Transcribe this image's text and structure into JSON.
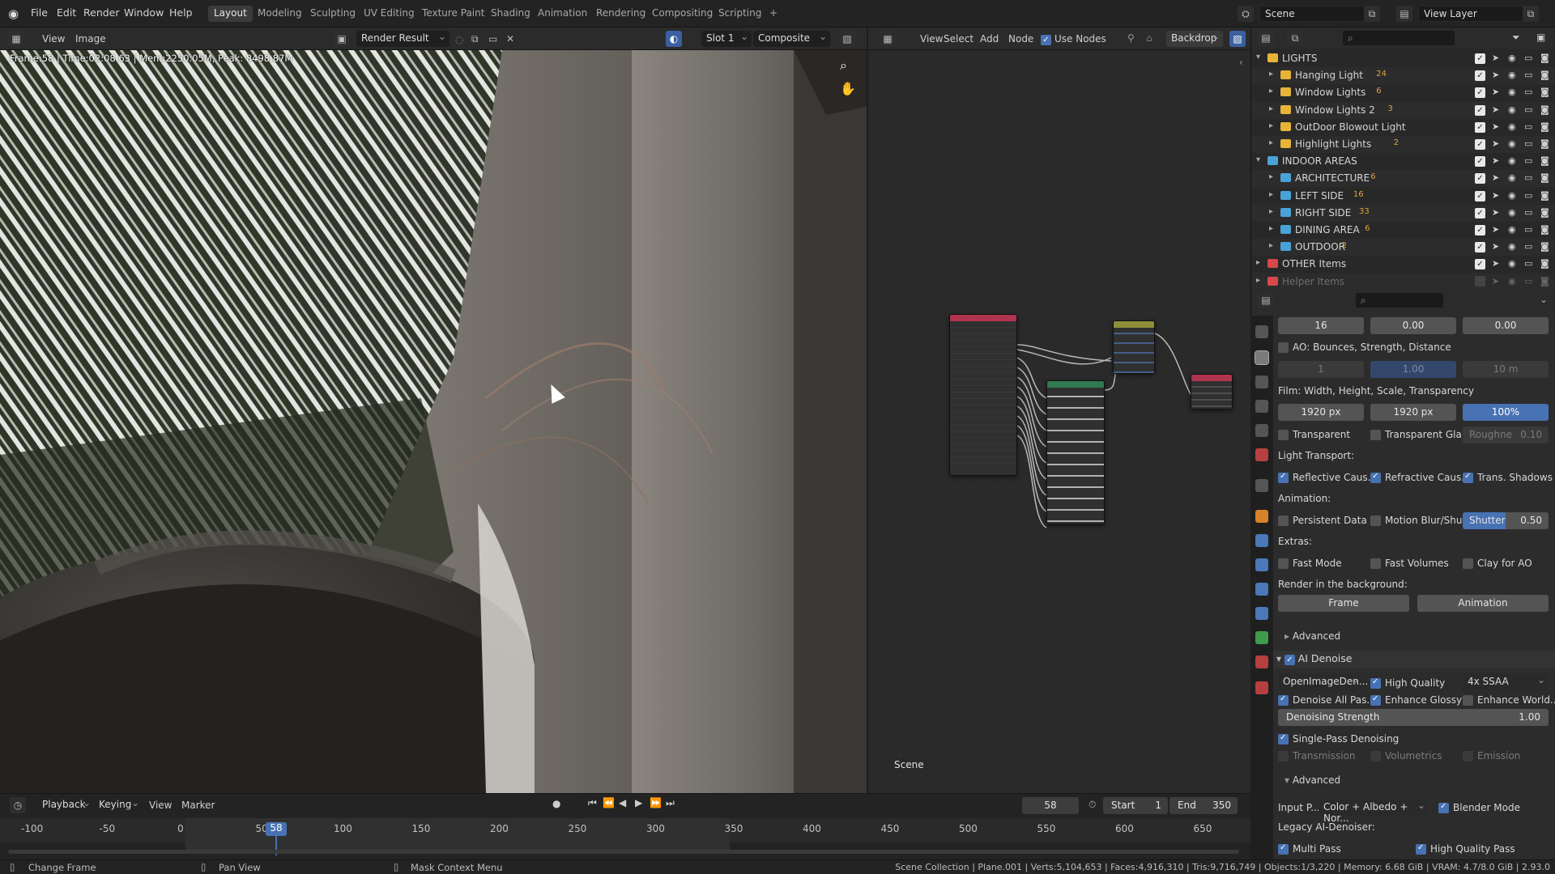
{
  "topbar": {
    "menus": [
      "File",
      "Edit",
      "Render",
      "Window",
      "Help"
    ],
    "workspaces": [
      "Layout",
      "Modeling",
      "Sculpting",
      "UV Editing",
      "Texture Paint",
      "Shading",
      "Animation",
      "Rendering",
      "Compositing",
      "Scripting"
    ],
    "active_workspace": "Layout",
    "add_tab": "+",
    "scene": "Scene",
    "view_layer": "View Layer"
  },
  "image_editor": {
    "menus": [
      "View",
      "Image"
    ],
    "image_name": "Render Result",
    "slot": "Slot 1",
    "layer": "Composite",
    "info": "Frame:58 | Time:02:08.63 | Mem:2250.05M, Peak: 8498.87M"
  },
  "node_editor": {
    "menus": [
      "View",
      "Select",
      "Add",
      "Node"
    ],
    "use_nodes": "Use Nodes",
    "backdrop": "Backdrop",
    "scene_label": "Scene"
  },
  "outliner": {
    "rows": [
      {
        "name": "LIGHTS",
        "level": 0,
        "color": "#e8b339",
        "open": true,
        "badges": ""
      },
      {
        "name": "Hanging Light",
        "level": 1,
        "color": "#e8b339",
        "badges": "24"
      },
      {
        "name": "Window Lights",
        "level": 1,
        "color": "#e8b339",
        "badges": "6"
      },
      {
        "name": "Window Lights 2",
        "level": 1,
        "color": "#e8b339",
        "badges": "3"
      },
      {
        "name": "OutDoor Blowout Light",
        "level": 1,
        "color": "#e8b339",
        "badges": ""
      },
      {
        "name": "Highlight Lights",
        "level": 1,
        "color": "#e8b339",
        "badges": "2"
      },
      {
        "name": "INDOOR AREAS",
        "level": 0,
        "color": "#4aa3d8",
        "open": true,
        "badges": ""
      },
      {
        "name": "ARCHITECTURE",
        "level": 1,
        "color": "#4aa3d8",
        "badges": "6"
      },
      {
        "name": "LEFT SIDE",
        "level": 1,
        "color": "#4aa3d8",
        "badges": "16"
      },
      {
        "name": "RIGHT SIDE",
        "level": 1,
        "color": "#4aa3d8",
        "badges": "33"
      },
      {
        "name": "DINING AREA",
        "level": 1,
        "color": "#4aa3d8",
        "badges": "6"
      },
      {
        "name": "OUTDOOR",
        "level": 1,
        "color": "#4aa3d8",
        "badges": "2"
      },
      {
        "name": "OTHER Items",
        "level": 0,
        "color": "#d8484a",
        "open": false,
        "badges": ""
      },
      {
        "name": "Helper Items",
        "level": 0,
        "color": "#d8484a",
        "open": false,
        "badges": "",
        "disabled": true
      }
    ]
  },
  "properties": {
    "row1": [
      "16",
      "0.00",
      "0.00"
    ],
    "ao_label": "AO: Bounces, Strength, Distance",
    "ao_values": [
      "1",
      "1.00",
      "10 m"
    ],
    "film_label": "Film: Width, Height, Scale, Transparency",
    "film_values": [
      "1920 px",
      "1920 px",
      "100%"
    ],
    "transparent": "Transparent",
    "transparent_gla": "Transparent Gla...",
    "roughne": "Roughne",
    "roughne_value": "0.10",
    "light_transport": "Light Transport:",
    "reflective_caus": "Reflective Caus...",
    "refractive_caus": "Refractive Caus...",
    "trans_shadows": "Trans. Shadows",
    "animation_label": "Animation:",
    "persistent_data": "Persistent Data",
    "motion_blur": "Motion Blur/Shu...",
    "shutter": "Shutter",
    "shutter_value": "0.50",
    "extras_label": "Extras:",
    "fast_mode": "Fast Mode",
    "fast_volumes": "Fast Volumes",
    "clay_for_ao": "Clay for AO",
    "render_bg": "Render in the background:",
    "frame_btn": "Frame",
    "animation_btn": "Animation",
    "advanced": "Advanced",
    "ai_denoise": "AI Denoise",
    "denoiser": "OpenImageDen...",
    "high_quality": "High Quality",
    "ssaa": "4x SSAA",
    "denoise_all": "Denoise All Pas...",
    "enhance_glossy": "Enhance Glossy",
    "enhance_world": "Enhance World...",
    "denoising_strength": "Denoising Strength",
    "denoising_strength_value": "1.00",
    "single_pass": "Single-Pass Denoising",
    "transmission": "Transmission",
    "volumetrics": "Volumetrics",
    "emission": "Emission",
    "advanced2": "Advanced",
    "input_p": "Input P...",
    "input_value": "Color + Albedo + Nor...",
    "blender_mode": "Blender Mode",
    "legacy": "Legacy AI-Denoiser:",
    "multi_pass": "Multi Pass",
    "high_quality_pass": "High Quality Pass"
  },
  "timeline": {
    "menus": [
      "Playback",
      "Keying",
      "View",
      "Marker"
    ],
    "current_frame": "58",
    "start_label": "Start",
    "start": "1",
    "end_label": "End",
    "end": "350",
    "ticks": [
      "-100",
      "-50",
      "0",
      "50",
      "100",
      "150",
      "200",
      "250",
      "300",
      "350",
      "400",
      "450",
      "500",
      "550",
      "600",
      "650"
    ],
    "playhead": "58"
  },
  "statusbar": {
    "change_frame": "Change Frame",
    "pan_view": "Pan View",
    "mask_menu": "Mask Context Menu",
    "stats": "Scene Collection | Plane.001 | Verts:5,104,653 | Faces:4,916,310 | Tris:9,716,749 | Objects:1/3,220 | Memory: 6.68 GiB | VRAM: 4.7/8.0 GiB | 2.93.0"
  }
}
